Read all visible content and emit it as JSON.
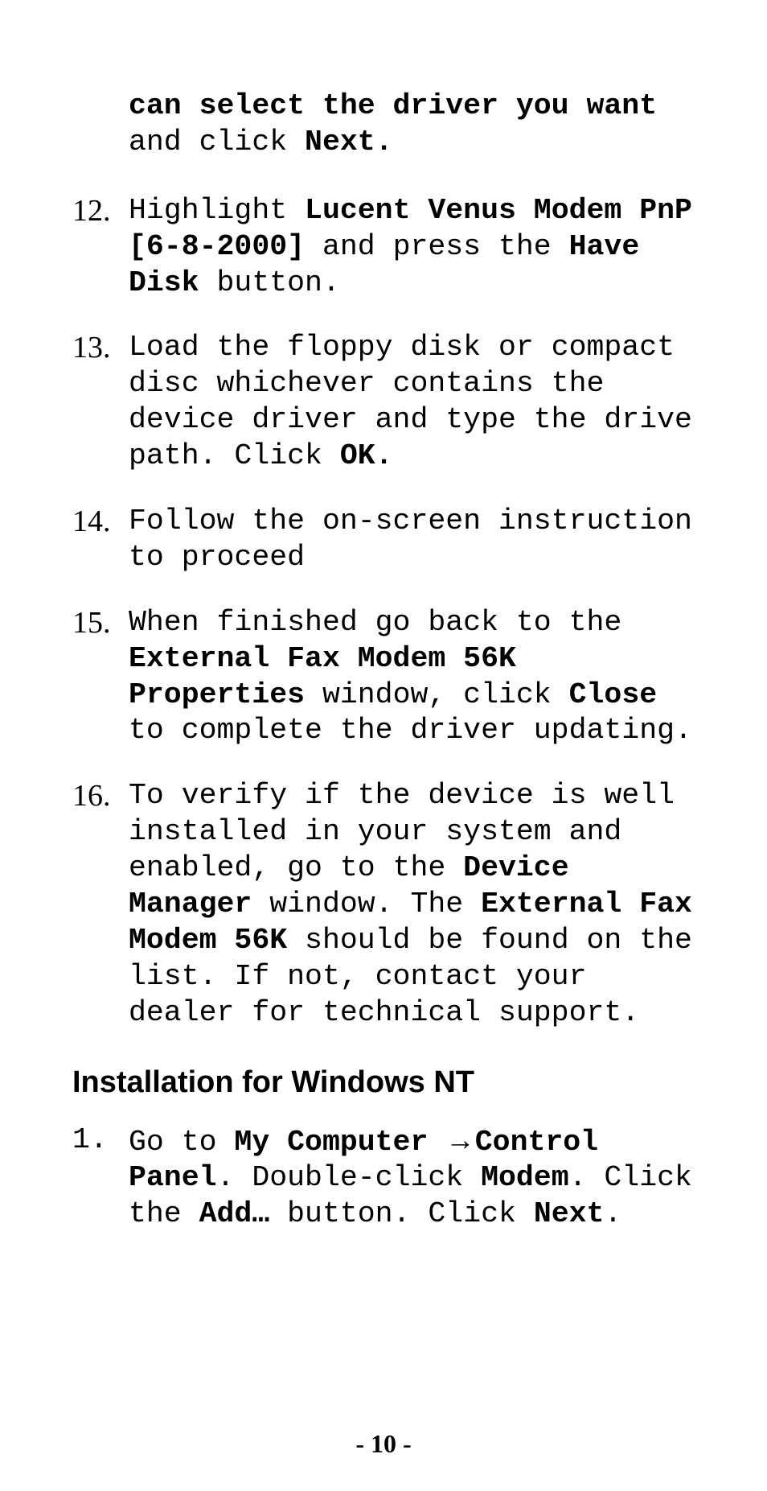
{
  "continuation": {
    "runs": [
      {
        "t": "can select the driver you want",
        "b": true
      },
      {
        "t": " and click ",
        "b": false
      },
      {
        "t": "Next.",
        "b": true
      }
    ]
  },
  "list1": [
    {
      "num": "12.",
      "runs": [
        {
          "t": "Highlight ",
          "b": false
        },
        {
          "t": "Lucent Venus Modem PnP [6-8-2000]",
          "b": true
        },
        {
          "t": " and press the ",
          "b": false
        },
        {
          "t": "Have Disk",
          "b": true
        },
        {
          "t": " button.",
          "b": false
        }
      ]
    },
    {
      "num": "13.",
      "runs": [
        {
          "t": "Load the floppy disk or compact disc whichever contains the device driver and type the drive path. Click ",
          "b": false
        },
        {
          "t": "OK.",
          "b": true
        }
      ]
    },
    {
      "num": "14.",
      "runs": [
        {
          "t": "Follow the on-screen instruction to proceed",
          "b": false
        }
      ]
    },
    {
      "num": "15.",
      "runs": [
        {
          "t": "When finished go back to the ",
          "b": false
        },
        {
          "t": "External Fax Modem 56K Properties",
          "b": true
        },
        {
          "t": " window, click ",
          "b": false
        },
        {
          "t": "Close",
          "b": true
        },
        {
          "t": " to complete the driver updating.",
          "b": false
        }
      ]
    },
    {
      "num": "16.",
      "runs": [
        {
          "t": "To verify if the device is well installed in your system and enabled, go to the ",
          "b": false
        },
        {
          "t": "Device Manager",
          "b": true
        },
        {
          "t": " window. The ",
          "b": false
        },
        {
          "t": "External Fax Modem 56K",
          "b": true
        },
        {
          "t": " should be found on the list. If not, contact your dealer for technical support.",
          "b": false
        }
      ]
    }
  ],
  "heading_nt": "Installation for Windows NT",
  "list2": [
    {
      "num": "1.",
      "runs": [
        {
          "t": "Go to ",
          "b": false
        },
        {
          "t": "My Computer ",
          "b": true
        },
        {
          "t": "→",
          "b": true,
          "arrow": true
        },
        {
          "t": "Control Panel",
          "b": true
        },
        {
          "t": ". Double-click ",
          "b": false
        },
        {
          "t": "Modem",
          "b": true
        },
        {
          "t": ". Click the ",
          "b": false
        },
        {
          "t": "Add…",
          "b": true
        },
        {
          "t": " button. Click ",
          "b": false
        },
        {
          "t": "Next",
          "b": true
        },
        {
          "t": ".",
          "b": false
        }
      ]
    }
  ],
  "page_number": "- 10 -"
}
